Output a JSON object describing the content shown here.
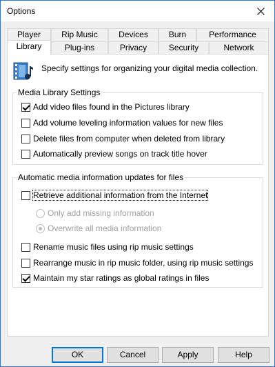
{
  "window": {
    "title": "Options"
  },
  "tabs": {
    "row1": [
      "Player",
      "Rip Music",
      "Devices",
      "Burn",
      "Performance"
    ],
    "row2": [
      "Library",
      "Plug-ins",
      "Privacy",
      "Security",
      "Network"
    ],
    "active": "Library"
  },
  "header": {
    "text": "Specify settings for organizing your digital media collection."
  },
  "media_library": {
    "title": "Media Library Settings",
    "options": [
      {
        "label": "Add video files found in the Pictures library",
        "checked": true
      },
      {
        "label": "Add volume leveling information values for new files",
        "checked": false
      },
      {
        "label": "Delete files from computer when deleted from library",
        "checked": false
      },
      {
        "label": "Automatically preview songs on track title hover",
        "checked": false
      }
    ]
  },
  "auto_updates": {
    "title": "Automatic media information updates for files",
    "retrieve": {
      "label": "Retrieve additional information from the Internet",
      "checked": false
    },
    "radios": [
      {
        "label": "Only add missing information",
        "selected": false
      },
      {
        "label": "Overwrite all media information",
        "selected": true
      }
    ],
    "options": [
      {
        "label": "Rename music files using rip music settings",
        "checked": false
      },
      {
        "label": "Rearrange music in rip music folder, using rip music settings",
        "checked": false
      },
      {
        "label": "Maintain my star ratings as global ratings in files",
        "checked": true
      }
    ]
  },
  "buttons": {
    "ok": "OK",
    "cancel": "Cancel",
    "apply": "Apply",
    "help": "Help"
  },
  "colors": {
    "titlebar_border": "#2b79d3",
    "default_button": "#0078d7"
  }
}
